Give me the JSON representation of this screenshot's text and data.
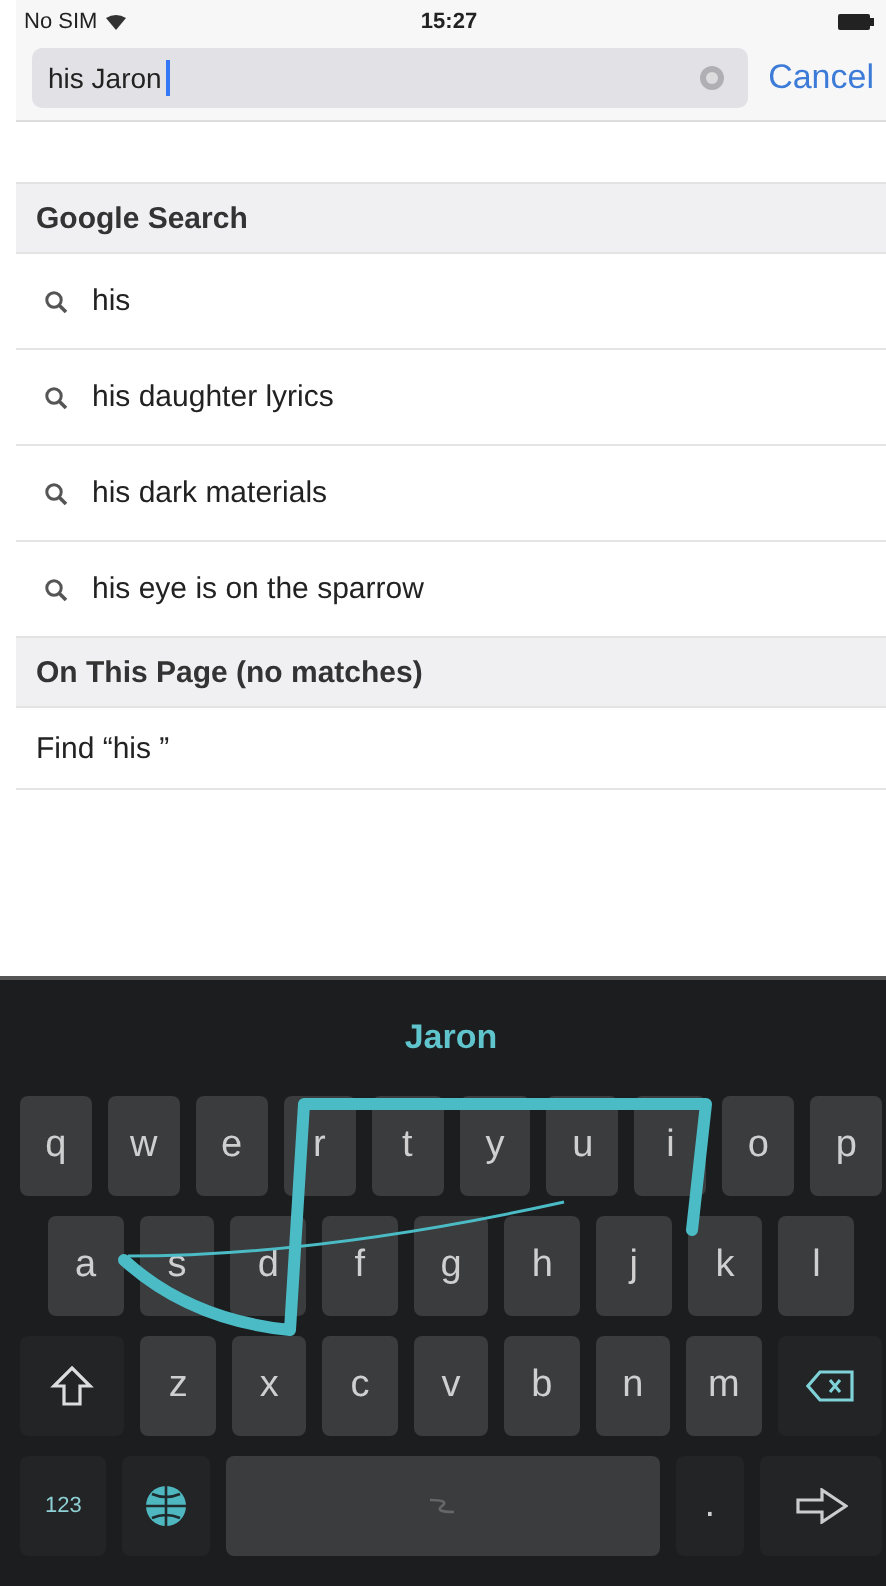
{
  "status_bar": {
    "carrier": "No SIM",
    "time": "15:27"
  },
  "search": {
    "value": "his Jaron",
    "cancel": "Cancel"
  },
  "sections": [
    {
      "title": "Google Search",
      "items": [
        {
          "kind": "suggestion",
          "text": "his"
        },
        {
          "kind": "suggestion",
          "text": "his daughter lyrics"
        },
        {
          "kind": "suggestion",
          "text": "his dark materials"
        },
        {
          "kind": "suggestion",
          "text": "his eye is on the sparrow"
        }
      ]
    },
    {
      "title": "On This Page (no matches)",
      "items": [
        {
          "kind": "find",
          "text": "Find “his ”"
        },
        {
          "kind": "blank"
        }
      ]
    }
  ],
  "keyboard": {
    "suggestion": "Jaron",
    "rows": [
      [
        {
          "kind": "letter",
          "label": "q"
        },
        {
          "kind": "letter",
          "label": "w"
        },
        {
          "kind": "letter",
          "label": "e"
        },
        {
          "kind": "letter",
          "label": "r"
        },
        {
          "kind": "letter",
          "label": "t"
        },
        {
          "kind": "letter",
          "label": "y"
        },
        {
          "kind": "letter",
          "label": "u"
        },
        {
          "kind": "letter",
          "label": "i"
        },
        {
          "kind": "letter",
          "label": "o"
        },
        {
          "kind": "letter",
          "label": "p"
        }
      ],
      [
        {
          "kind": "letter",
          "label": "a"
        },
        {
          "kind": "letter",
          "label": "s"
        },
        {
          "kind": "letter",
          "label": "d"
        },
        {
          "kind": "letter",
          "label": "f"
        },
        {
          "kind": "letter",
          "label": "g"
        },
        {
          "kind": "letter",
          "label": "h"
        },
        {
          "kind": "letter",
          "label": "j"
        },
        {
          "kind": "letter",
          "label": "k"
        },
        {
          "kind": "letter",
          "label": "l"
        }
      ],
      [
        {
          "kind": "shift"
        },
        {
          "kind": "letter",
          "label": "z"
        },
        {
          "kind": "letter",
          "label": "x"
        },
        {
          "kind": "letter",
          "label": "c"
        },
        {
          "kind": "letter",
          "label": "v"
        },
        {
          "kind": "letter",
          "label": "b"
        },
        {
          "kind": "letter",
          "label": "n"
        },
        {
          "kind": "letter",
          "label": "m"
        },
        {
          "kind": "backspace"
        }
      ],
      [
        {
          "kind": "numbers",
          "label": "123"
        },
        {
          "kind": "globe"
        },
        {
          "kind": "space"
        },
        {
          "kind": "punct",
          "label": "."
        },
        {
          "kind": "enter"
        }
      ]
    ]
  }
}
